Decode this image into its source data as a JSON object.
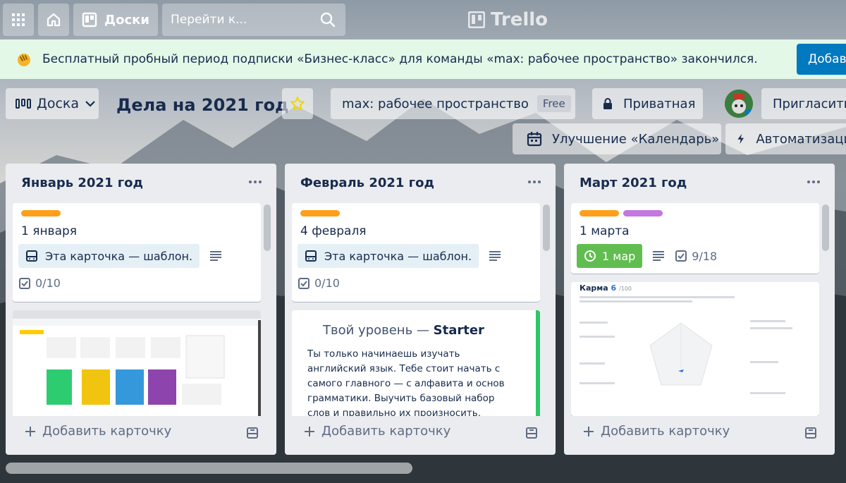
{
  "header": {
    "boards_label": "Доски",
    "search_placeholder": "Перейти к...",
    "logo_text": "Trello"
  },
  "banner": {
    "text": "Бесплатный пробный период подписки «Бизнес-класс» для команды «max: рабочее пространство» закончился.",
    "cta_label": "Добавить"
  },
  "board_header": {
    "view_label": "Доска",
    "title": "Дела на 2021 год",
    "workspace_label": "max: рабочее пространство",
    "workspace_badge": "Free",
    "visibility_label": "Приватная",
    "invite_label": "Пригласить",
    "calendar_label": "Улучшение «Календарь»",
    "automation_label": "Автоматизация"
  },
  "colors": {
    "label_orange": "#ff9f1a",
    "label_purple": "#c377e0",
    "due_green": "#61bd4f",
    "banner_bg": "#e3f8e7",
    "cta_blue": "#0079bf"
  },
  "lists": [
    {
      "title": "Январь 2021 год",
      "card_title": "1 января",
      "template_badge": "Эта карточка — шаблон.",
      "checklist": "0/10",
      "add_card_label": "Добавить карточку"
    },
    {
      "title": "Февраль 2021 год",
      "card_title": "4 февраля",
      "template_badge": "Эта карточка — шаблон.",
      "checklist": "0/10",
      "add_card_label": "Добавить карточку",
      "cover": {
        "title_prefix": "Твой уровень — ",
        "title_bold": "Starter",
        "body": "Ты только начинаешь изучать английский язык. Тебе стоит начать с самого главного — с алфавита и основ грамматики. Выучить базовый набор слов и правильно их произносить."
      }
    },
    {
      "title": "Март 2021 год",
      "card_title": "1 марта",
      "due_label": "1 мар",
      "checklist": "9/18",
      "add_card_label": "Добавить карточку",
      "cover": {
        "title": "Карма",
        "score": "6",
        "max": "/100"
      }
    }
  ]
}
